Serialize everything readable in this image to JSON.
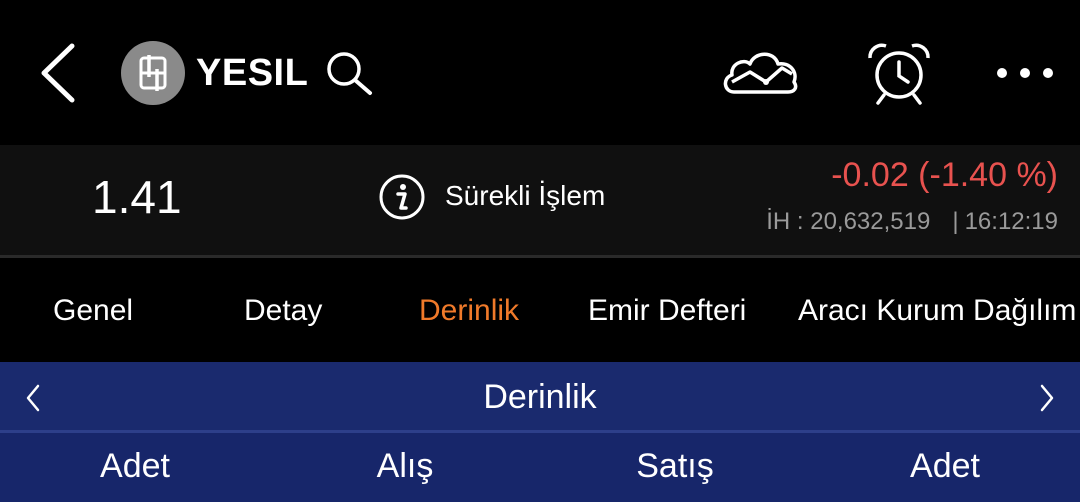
{
  "header": {
    "symbol": "YESIL",
    "logo_text": "ꝺ"
  },
  "quote": {
    "price": "1.41",
    "session_status": "Sürekli İşlem",
    "change": "-0.02 (-1.40 %)",
    "volume_label": "İH : 20,632,519",
    "separator": "|",
    "time": "16:12:19"
  },
  "tabs": [
    {
      "label": "Genel"
    },
    {
      "label": "Detay"
    },
    {
      "label": "Derinlik"
    },
    {
      "label": "Emir Defteri"
    },
    {
      "label": "Aracı Kurum Dağılım"
    }
  ],
  "active_tab": "Derinlik",
  "section": {
    "title": "Derinlik"
  },
  "columns": [
    "Adet",
    "Alış",
    "Satış",
    "Adet"
  ],
  "colors": {
    "background": "#000000",
    "price_bar": "#101010",
    "active_tab": "#f07a2a",
    "negative_change": "#e8524f",
    "section_header": "#1a2a6e",
    "column_header": "#17266a",
    "muted_text": "#9a9a9a"
  },
  "icons": {
    "back": "chevron-left-icon",
    "search": "search-icon",
    "cloud": "cloud-chart-icon",
    "alarm": "alarm-clock-icon",
    "more": "more-dots-icon",
    "info": "info-icon"
  }
}
